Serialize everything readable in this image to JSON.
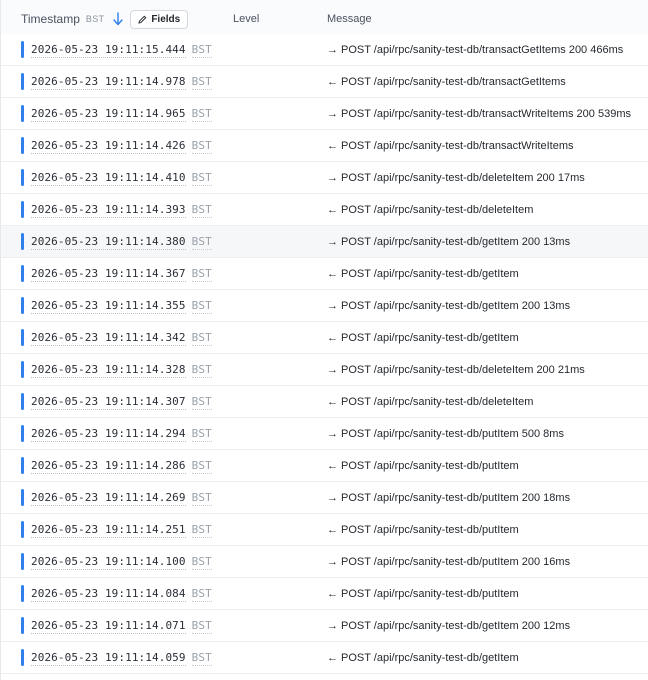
{
  "header": {
    "timestamp_label": "Timestamp",
    "timezone": "BST",
    "fields_label": "Fields",
    "level_label": "Level",
    "message_label": "Message"
  },
  "colors": {
    "level_bar": "#2f80ed"
  },
  "rows": [
    {
      "timestamp": "2026-05-23 19:11:15.444",
      "tz": "BST",
      "direction": "→",
      "message": "POST /api/rpc/sanity-test-db/transactGetItems 200 466ms"
    },
    {
      "timestamp": "2026-05-23 19:11:14.978",
      "tz": "BST",
      "direction": "←",
      "message": "POST /api/rpc/sanity-test-db/transactGetItems"
    },
    {
      "timestamp": "2026-05-23 19:11:14.965",
      "tz": "BST",
      "direction": "→",
      "message": "POST /api/rpc/sanity-test-db/transactWriteItems 200 539ms"
    },
    {
      "timestamp": "2026-05-23 19:11:14.426",
      "tz": "BST",
      "direction": "←",
      "message": "POST /api/rpc/sanity-test-db/transactWriteItems"
    },
    {
      "timestamp": "2026-05-23 19:11:14.410",
      "tz": "BST",
      "direction": "→",
      "message": "POST /api/rpc/sanity-test-db/deleteItem 200 17ms"
    },
    {
      "timestamp": "2026-05-23 19:11:14.393",
      "tz": "BST",
      "direction": "←",
      "message": "POST /api/rpc/sanity-test-db/deleteItem"
    },
    {
      "timestamp": "2026-05-23 19:11:14.380",
      "tz": "BST",
      "direction": "→",
      "message": "POST /api/rpc/sanity-test-db/getItem 200 13ms"
    },
    {
      "timestamp": "2026-05-23 19:11:14.367",
      "tz": "BST",
      "direction": "←",
      "message": "POST /api/rpc/sanity-test-db/getItem"
    },
    {
      "timestamp": "2026-05-23 19:11:14.355",
      "tz": "BST",
      "direction": "→",
      "message": "POST /api/rpc/sanity-test-db/getItem 200 13ms"
    },
    {
      "timestamp": "2026-05-23 19:11:14.342",
      "tz": "BST",
      "direction": "←",
      "message": "POST /api/rpc/sanity-test-db/getItem"
    },
    {
      "timestamp": "2026-05-23 19:11:14.328",
      "tz": "BST",
      "direction": "→",
      "message": "POST /api/rpc/sanity-test-db/deleteItem 200 21ms"
    },
    {
      "timestamp": "2026-05-23 19:11:14.307",
      "tz": "BST",
      "direction": "←",
      "message": "POST /api/rpc/sanity-test-db/deleteItem"
    },
    {
      "timestamp": "2026-05-23 19:11:14.294",
      "tz": "BST",
      "direction": "→",
      "message": "POST /api/rpc/sanity-test-db/putItem 500 8ms"
    },
    {
      "timestamp": "2026-05-23 19:11:14.286",
      "tz": "BST",
      "direction": "←",
      "message": "POST /api/rpc/sanity-test-db/putItem"
    },
    {
      "timestamp": "2026-05-23 19:11:14.269",
      "tz": "BST",
      "direction": "→",
      "message": "POST /api/rpc/sanity-test-db/putItem 200 18ms"
    },
    {
      "timestamp": "2026-05-23 19:11:14.251",
      "tz": "BST",
      "direction": "←",
      "message": "POST /api/rpc/sanity-test-db/putItem"
    },
    {
      "timestamp": "2026-05-23 19:11:14.100",
      "tz": "BST",
      "direction": "→",
      "message": "POST /api/rpc/sanity-test-db/putItem 200 16ms"
    },
    {
      "timestamp": "2026-05-23 19:11:14.084",
      "tz": "BST",
      "direction": "←",
      "message": "POST /api/rpc/sanity-test-db/putItem"
    },
    {
      "timestamp": "2026-05-23 19:11:14.071",
      "tz": "BST",
      "direction": "→",
      "message": "POST /api/rpc/sanity-test-db/getItem 200 12ms"
    },
    {
      "timestamp": "2026-05-23 19:11:14.059",
      "tz": "BST",
      "direction": "←",
      "message": "POST /api/rpc/sanity-test-db/getItem"
    }
  ]
}
